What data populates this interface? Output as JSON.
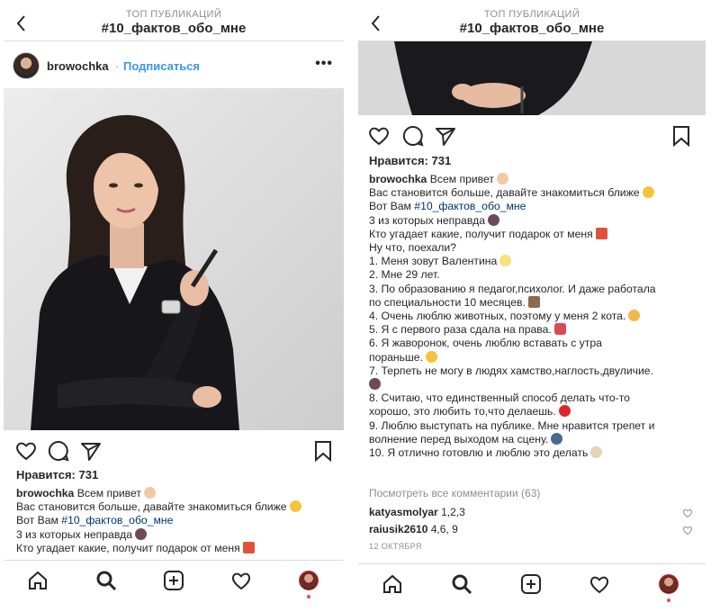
{
  "header": {
    "subtitle": "ТОП ПУБЛИКАЦИЙ",
    "title": "#10_фактов_обо_мне"
  },
  "post": {
    "username": "browochka",
    "dot": "·",
    "follow_label": "Подписаться",
    "more_label": "•••",
    "likes": "Нравится: 731",
    "caption_greeting": "Всем привет",
    "caption_lines": [
      "Вас становится больше, давайте знакомиться ближе",
      "Вот Вам",
      "3 из которых неправда",
      "Кто угадает какие, получит подарок от меня",
      "Ну что, поехали?",
      "1. Меня зовут Валентина",
      "2. Мне 29 лет.",
      "3. По образованию я педагог,психолог. И даже работала",
      "по специальности 10 месяцев.",
      "4. Очень люблю животных, поэтому у меня 2 кота.",
      "5. Я с первого раза сдала на права.",
      "6. Я жаворонок, очень люблю вставать с утра",
      "пораньше.",
      "7. Терпеть не могу в людях хамство,наглость,двуличие.",
      "8. Считаю, что единственный способ делать что-то",
      "хорошо, это любить то,что делаешь.",
      "9. Люблю выступать на публике. Мне нравится трепет и",
      "волнение перед выходом на сцену.",
      "10. Я отлично готовлю и люблю это делать"
    ],
    "hashtag": "#10_фактов_обо_мне",
    "view_all_comments": "Посмотреть все комментарии (63)",
    "comments": [
      {
        "user": "katyasmolyar",
        "text": "1,2,3"
      },
      {
        "user": "raiusik2610",
        "text": "4,6, 9"
      }
    ],
    "date": "12 ОКТЯБРЯ"
  },
  "icons": {
    "back": "chevron-left-icon",
    "like": "heart-icon",
    "comment": "comment-icon",
    "share": "paper-plane-icon",
    "save": "bookmark-icon",
    "nav": [
      "home-icon",
      "search-icon",
      "add-post-icon",
      "activity-heart-icon",
      "profile-avatar"
    ]
  },
  "colors": {
    "link": "#3897f0",
    "hashtag": "#003569",
    "muted": "#8e8e8e",
    "notification": "#ed4956"
  }
}
